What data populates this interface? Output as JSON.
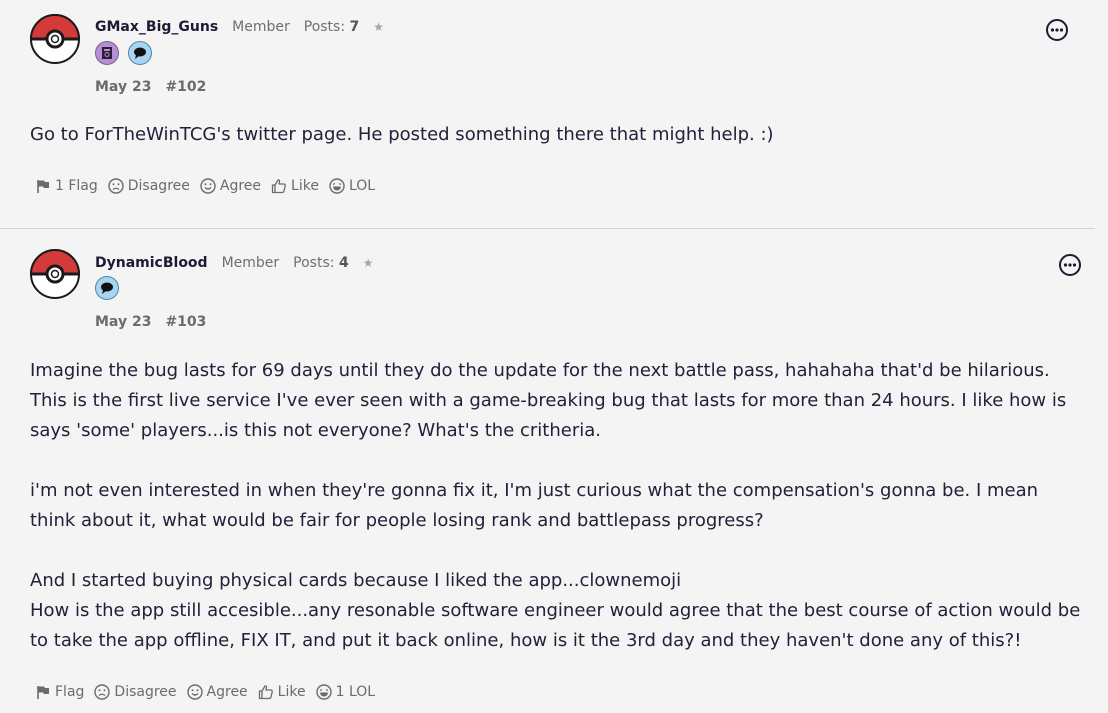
{
  "posts": [
    {
      "username": "GMax_Big_Guns",
      "role": "Member",
      "posts_label": "Posts:",
      "posts_count": "7",
      "star": "★",
      "badges": [
        "book-badge",
        "comment-badge"
      ],
      "date": "May 23",
      "number": "#102",
      "body": [
        "Go to ForTheWinTCG's twitter page. He posted something there that might help. :)"
      ],
      "reactions": {
        "flag": "1 Flag",
        "disagree": "Disagree",
        "agree": "Agree",
        "like": "Like",
        "lol": "LOL"
      }
    },
    {
      "username": "DynamicBlood",
      "role": "Member",
      "posts_label": "Posts:",
      "posts_count": "4",
      "star": "★",
      "badges": [
        "comment-badge"
      ],
      "date": "May 23",
      "number": "#103",
      "body": [
        "Imagine the bug lasts for 69 days until they do the update for the next battle pass, hahahaha that'd be hilarious. This is the first live service I've ever seen with a game-breaking bug that lasts for more than 24 hours. I like how is says 'some' players...is this not everyone? What's the critheria.",
        "i'm not even interested in when they're gonna fix it, I'm just curious what the compensation's gonna be. I mean think about it, what would be fair for people losing rank and battlepass progress?",
        "And I started buying physical cards because I liked the app...clownemoji",
        "How is the app still accesible...any resonable software engineer would agree that the best course of action would be to take the app offline, FIX IT, and put it back online, how is it the 3rd day and they haven't done any of this?!"
      ],
      "reactions": {
        "flag": "Flag",
        "disagree": "Disagree",
        "agree": "Agree",
        "like": "Like",
        "lol": "1 LOL"
      }
    }
  ],
  "colors": {
    "background": "#f4f4f4",
    "text": "#21213a",
    "muted": "#6b6b6b",
    "pokeball_red": "#d33a3a"
  }
}
